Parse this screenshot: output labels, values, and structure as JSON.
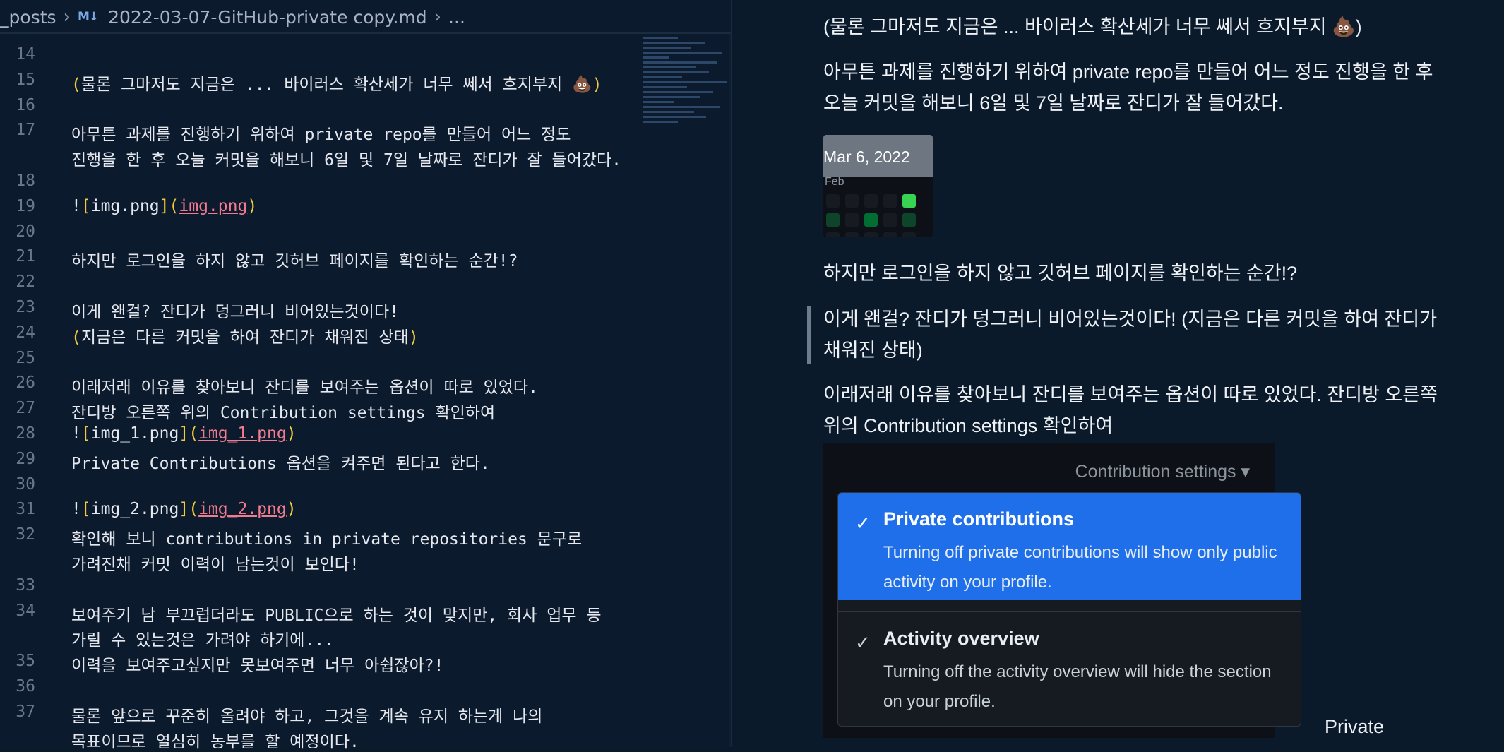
{
  "breadcrumb": {
    "folder": "_posts",
    "file_icon": "M↓",
    "file": "2022-03-07-GitHub-private copy.md",
    "ellipsis": "..."
  },
  "lines": [
    {
      "n": "14",
      "parts": []
    },
    {
      "n": "15",
      "parts": [
        {
          "t": "(",
          "c": "yb"
        },
        {
          "t": "물론 그마저도 지금은 ... 바이러스 확산세가 너무 쎄서 흐지부지 💩"
        },
        {
          "t": ")",
          "c": "yb"
        }
      ]
    },
    {
      "n": "16",
      "parts": []
    },
    {
      "n": "17",
      "parts": [
        {
          "t": "아무튼 과제를 진행하기 위하여 private repo를 만들어 어느 정도"
        }
      ]
    },
    {
      "n": "",
      "parts": [
        {
          "t": "진행을 한 후 오늘 커밋을 해보니 6일 및 7일 날짜로 잔디가 잘 들어갔다."
        }
      ]
    },
    {
      "n": "18",
      "parts": []
    },
    {
      "n": "19",
      "parts": [
        {
          "t": "!"
        },
        {
          "t": "[",
          "c": "yb"
        },
        {
          "t": "img.png"
        },
        {
          "t": "]",
          "c": "yb"
        },
        {
          "t": "(",
          "c": "yb"
        },
        {
          "t": "img.png",
          "c": "lk"
        },
        {
          "t": ")",
          "c": "yb"
        }
      ]
    },
    {
      "n": "20",
      "parts": []
    },
    {
      "n": "21",
      "parts": [
        {
          "t": "하지만 로그인을 하지 않고 깃허브 페이지를 확인하는 순간!?"
        }
      ]
    },
    {
      "n": "22",
      "parts": []
    },
    {
      "n": "23",
      "parts": [
        {
          "t": "이게 왠걸? 잔디가 덩그러니 비어있는것이다!"
        }
      ]
    },
    {
      "n": "24",
      "parts": [
        {
          "t": "(",
          "c": "yb"
        },
        {
          "t": "지금은 다른 커밋을 하여 잔디가 채워진 상태"
        },
        {
          "t": ")",
          "c": "yb"
        }
      ]
    },
    {
      "n": "25",
      "parts": []
    },
    {
      "n": "26",
      "parts": [
        {
          "t": "이래저래 이유를 찾아보니 잔디를 보여주는 옵션이 따로 있었다."
        }
      ]
    },
    {
      "n": "27",
      "parts": [
        {
          "t": "잔디방 오른쪽 위의 Contribution settings 확인하여"
        }
      ]
    },
    {
      "n": "28",
      "parts": [
        {
          "t": "!"
        },
        {
          "t": "[",
          "c": "yb"
        },
        {
          "t": "img_1.png"
        },
        {
          "t": "]",
          "c": "yb"
        },
        {
          "t": "(",
          "c": "yb"
        },
        {
          "t": "img_1.png",
          "c": "lk"
        },
        {
          "t": ")",
          "c": "yb"
        }
      ]
    },
    {
      "n": "29",
      "parts": [
        {
          "t": "Private Contributions 옵션을 켜주면 된다고 한다."
        }
      ]
    },
    {
      "n": "30",
      "parts": []
    },
    {
      "n": "31",
      "parts": [
        {
          "t": "!"
        },
        {
          "t": "[",
          "c": "yb"
        },
        {
          "t": "img_2.png"
        },
        {
          "t": "]",
          "c": "yb"
        },
        {
          "t": "(",
          "c": "yb"
        },
        {
          "t": "img_2.png",
          "c": "lk"
        },
        {
          "t": ")",
          "c": "yb"
        }
      ]
    },
    {
      "n": "32",
      "parts": [
        {
          "t": "확인해 보니 contributions in private repositories 문구로"
        }
      ]
    },
    {
      "n": "",
      "parts": [
        {
          "t": "가려진채 커밋 이력이 남는것이 보인다!"
        }
      ]
    },
    {
      "n": "33",
      "parts": []
    },
    {
      "n": "34",
      "parts": [
        {
          "t": "보여주기 남 부끄럽더라도 PUBLIC으로 하는 것이 맞지만, 회사 업무 등"
        }
      ]
    },
    {
      "n": "",
      "parts": [
        {
          "t": "가릴 수 있는것은 가려야 하기에..."
        }
      ]
    },
    {
      "n": "35",
      "parts": [
        {
          "t": "이력을 보여주고싶지만 못보여주면 너무 아쉽잖아?!"
        }
      ]
    },
    {
      "n": "36",
      "parts": []
    },
    {
      "n": "37",
      "parts": [
        {
          "t": "물론 앞으로 꾸준히 올려야 하고, 그것을 계속 유지 하는게 나의"
        }
      ]
    },
    {
      "n": "",
      "parts": [
        {
          "t": "목표이므로 열심히 농부를 할 예정이다."
        }
      ]
    }
  ],
  "preview": {
    "p1": "(물론 그마저도 지금은 ... 바이러스 확산세가 너무 쎄서 흐지부지 💩)",
    "p2": "아무튼 과제를 진행하기 위하여 private repo를 만들어 어느 정도 진행을 한 후 오늘 커밋을 해보니 6일 및 7일 날짜로 잔디가 잘 들어갔다.",
    "img1_tooltip": "Mar 6, 2022",
    "img1_month": "Feb",
    "p3": "하지만 로그인을 하지 않고 깃허브 페이지를 확인하는 순간!?",
    "quote": "이게 왠걸? 잔디가 덩그러니 비어있는것이다! (지금은 다른 커밋을 하여 잔디가 채워진 상태)",
    "p4": "이래저래 이유를 찾아보니 잔디를 보여주는 옵션이 따로 있었다. 잔디방 오른쪽 위의 Contribution settings 확인하여",
    "img2": {
      "settings": "Contribution settings ▾",
      "opt1_title": "Private contributions",
      "opt1_desc": "Turning off private contributions will show only public activity on your profile.",
      "opt2_title": "Activity overview",
      "opt2_desc": "Turning off the activity overview will hide the section on your profile.",
      "check": "✓"
    },
    "tail": "Private"
  },
  "colors": {
    "punctuation": "#f2cc3c",
    "link": "#f37b8f",
    "selected_option": "#1f6feb",
    "contribution_green": "#39d353"
  }
}
